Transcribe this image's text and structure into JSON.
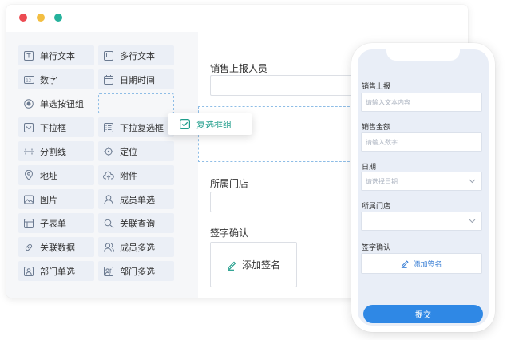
{
  "window": {
    "palette": {
      "items": [
        {
          "label": "单行文本",
          "icon": "text-field-icon"
        },
        {
          "label": "多行文本",
          "icon": "textarea-icon"
        },
        {
          "label": "数字",
          "icon": "number-icon"
        },
        {
          "label": "日期时间",
          "icon": "calendar-icon"
        },
        {
          "label": "单选按钮组",
          "icon": "radio-icon"
        },
        {
          "label": "",
          "icon": ""
        },
        {
          "label": "下拉框",
          "icon": "dropdown-icon"
        },
        {
          "label": "下拉复选框",
          "icon": "list-checkbox-icon"
        },
        {
          "label": "分割线",
          "icon": "divider-icon"
        },
        {
          "label": "定位",
          "icon": "locate-icon"
        },
        {
          "label": "地址",
          "icon": "map-pin-icon"
        },
        {
          "label": "附件",
          "icon": "upload-cloud-icon"
        },
        {
          "label": "图片",
          "icon": "image-icon"
        },
        {
          "label": "成员单选",
          "icon": "user-icon"
        },
        {
          "label": "子表单",
          "icon": "subform-icon"
        },
        {
          "label": "关联查询",
          "icon": "link-search-icon"
        },
        {
          "label": "关联数据",
          "icon": "link-data-icon"
        },
        {
          "label": "成员多选",
          "icon": "users-icon"
        },
        {
          "label": "部门单选",
          "icon": "department-icon"
        },
        {
          "label": "部门多选",
          "icon": "departments-icon"
        }
      ],
      "dragging": {
        "label": "复选框组",
        "icon": "checkbox-icon"
      }
    },
    "form": {
      "fields": [
        {
          "label": "销售上报人员"
        },
        {
          "label": "所属门店"
        },
        {
          "label": "签字确认"
        }
      ],
      "signature_label": "添加签名"
    }
  },
  "phone": {
    "fields": [
      {
        "label": "销售上报",
        "placeholder": "请输入文本内容"
      },
      {
        "label": "销售金额",
        "placeholder": "请输入数字"
      },
      {
        "label": "日期",
        "placeholder": "请选择日期"
      },
      {
        "label": "所属门店",
        "placeholder": ""
      },
      {
        "label": "签字确认",
        "placeholder": ""
      }
    ],
    "signature_label": "添加签名",
    "submit_label": "提交"
  },
  "colors": {
    "accent": "#2f88e5",
    "teal": "#1f9d8b",
    "mac_red": "#ec4b52",
    "mac_yellow": "#f3be41",
    "mac_green": "#26b29c"
  }
}
